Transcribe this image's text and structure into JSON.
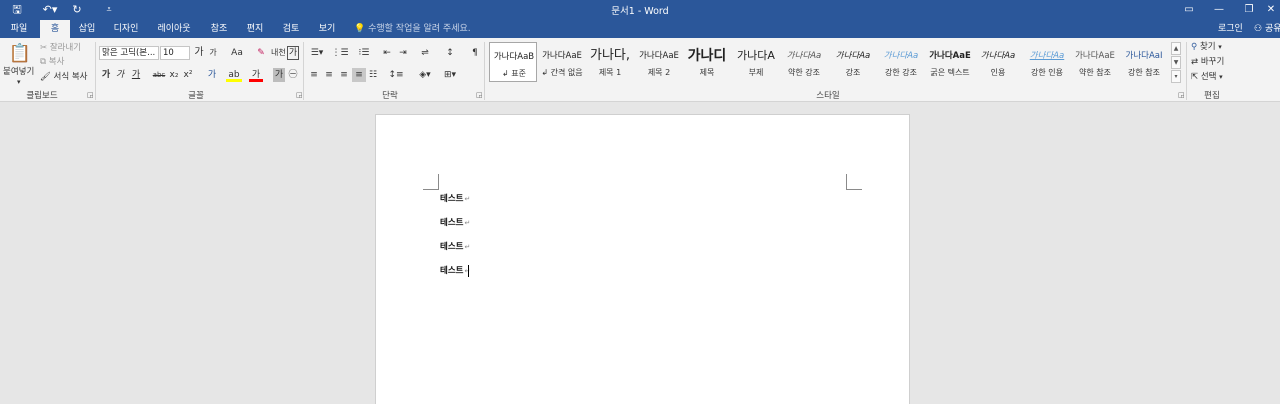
{
  "window": {
    "title": "문서1 - Word",
    "qat": {
      "save": "🖫",
      "undo": "↶▾",
      "redo": "↻",
      "customize": "⩡"
    },
    "controls": {
      "ribbon_display": "▭",
      "minimize": "—",
      "restore": "❐",
      "close": "✕"
    }
  },
  "tabs": [
    "파일",
    "홈",
    "삽입",
    "디자인",
    "레이아웃",
    "참조",
    "편지",
    "검토",
    "보기"
  ],
  "tell_me": "수행할 작업을 알려 주세요.",
  "login": "로그인",
  "share": "공유",
  "clipboard": {
    "paste": "붙여넣기",
    "cut": "잘라내기",
    "copy": "복사",
    "format_painter": "서식 복사",
    "label": "클립보드"
  },
  "font": {
    "name": "맑은 고딕(본...",
    "size": "10",
    "grow": "가",
    "shrink": "가",
    "case": "Aa",
    "clear": "✎",
    "phonetic": "내천",
    "border_char": "가",
    "bold": "가",
    "italic": "가",
    "underline": "가",
    "strike": "abc",
    "subscript": "x₂",
    "superscript": "x²",
    "effects": "가",
    "highlight": "ab",
    "color": "가",
    "shading": "가",
    "enclosed": "㊀",
    "label": "글꼴"
  },
  "paragraph": {
    "label": "단락"
  },
  "styles": {
    "label": "스타일",
    "items": [
      {
        "preview": "가나다AaB",
        "name": "↲ 표준"
      },
      {
        "preview": "가나다AaE",
        "name": "↲ 간격 없음"
      },
      {
        "preview": "가나다,",
        "name": "제목 1"
      },
      {
        "preview": "가나다AaE",
        "name": "제목 2"
      },
      {
        "preview": "가나디",
        "name": "제목"
      },
      {
        "preview": "가나다A",
        "name": "부제"
      },
      {
        "preview": "가나다Aa",
        "name": "약한 강조"
      },
      {
        "preview": "가나다Aa",
        "name": "강조"
      },
      {
        "preview": "가나다Aa",
        "name": "강한 강조"
      },
      {
        "preview": "가나다AaE",
        "name": "굵은 텍스트"
      },
      {
        "preview": "가나다Aa",
        "name": "인용"
      },
      {
        "preview": "가나다Aa",
        "name": "강한 인용"
      },
      {
        "preview": "가나다AaE",
        "name": "약한 참조"
      },
      {
        "preview": "가나다AaI",
        "name": "강한 참조"
      }
    ]
  },
  "editing": {
    "find": "찾기",
    "replace": "바꾸기",
    "select": "선택",
    "label": "편집"
  },
  "document": {
    "paragraphs": [
      "테스트",
      "테스트",
      "테스트",
      "테스트"
    ],
    "para_mark": "↵"
  },
  "colors": {
    "accent": "#2b579a",
    "highlight": "#ffff00",
    "font_color": "#ff0000"
  }
}
